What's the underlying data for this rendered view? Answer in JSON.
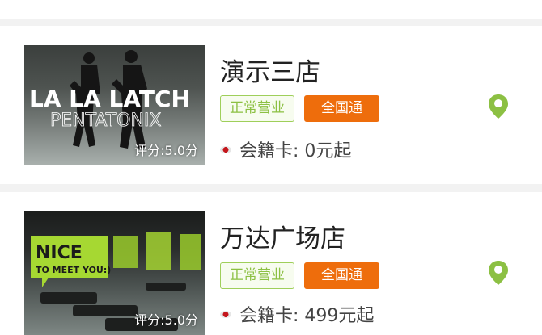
{
  "stores": [
    {
      "name": "演示三店",
      "status_tag": "正常营业",
      "scope_tag": "全国通",
      "rating": "评分:5.0分",
      "membership": "会籍卡: 0元起",
      "thumb_text_main": "LA LA LATCH",
      "thumb_text_sub": "PENTATONIX"
    },
    {
      "name": "万达广场店",
      "status_tag": "正常营业",
      "scope_tag": "全国通",
      "rating": "评分:5.0分",
      "membership": "会籍卡: 499元起",
      "thumb_text_main": "NICE",
      "thumb_text_sub": "TO MEET YOU:)"
    }
  ],
  "colors": {
    "open_tag": "#8cc043",
    "national_tag": "#ee6d0c",
    "location_pin": "#8cc043",
    "background": "#f2f2f2"
  },
  "icons": [
    "location-pin-icon",
    "bullet-dot-icon"
  ]
}
